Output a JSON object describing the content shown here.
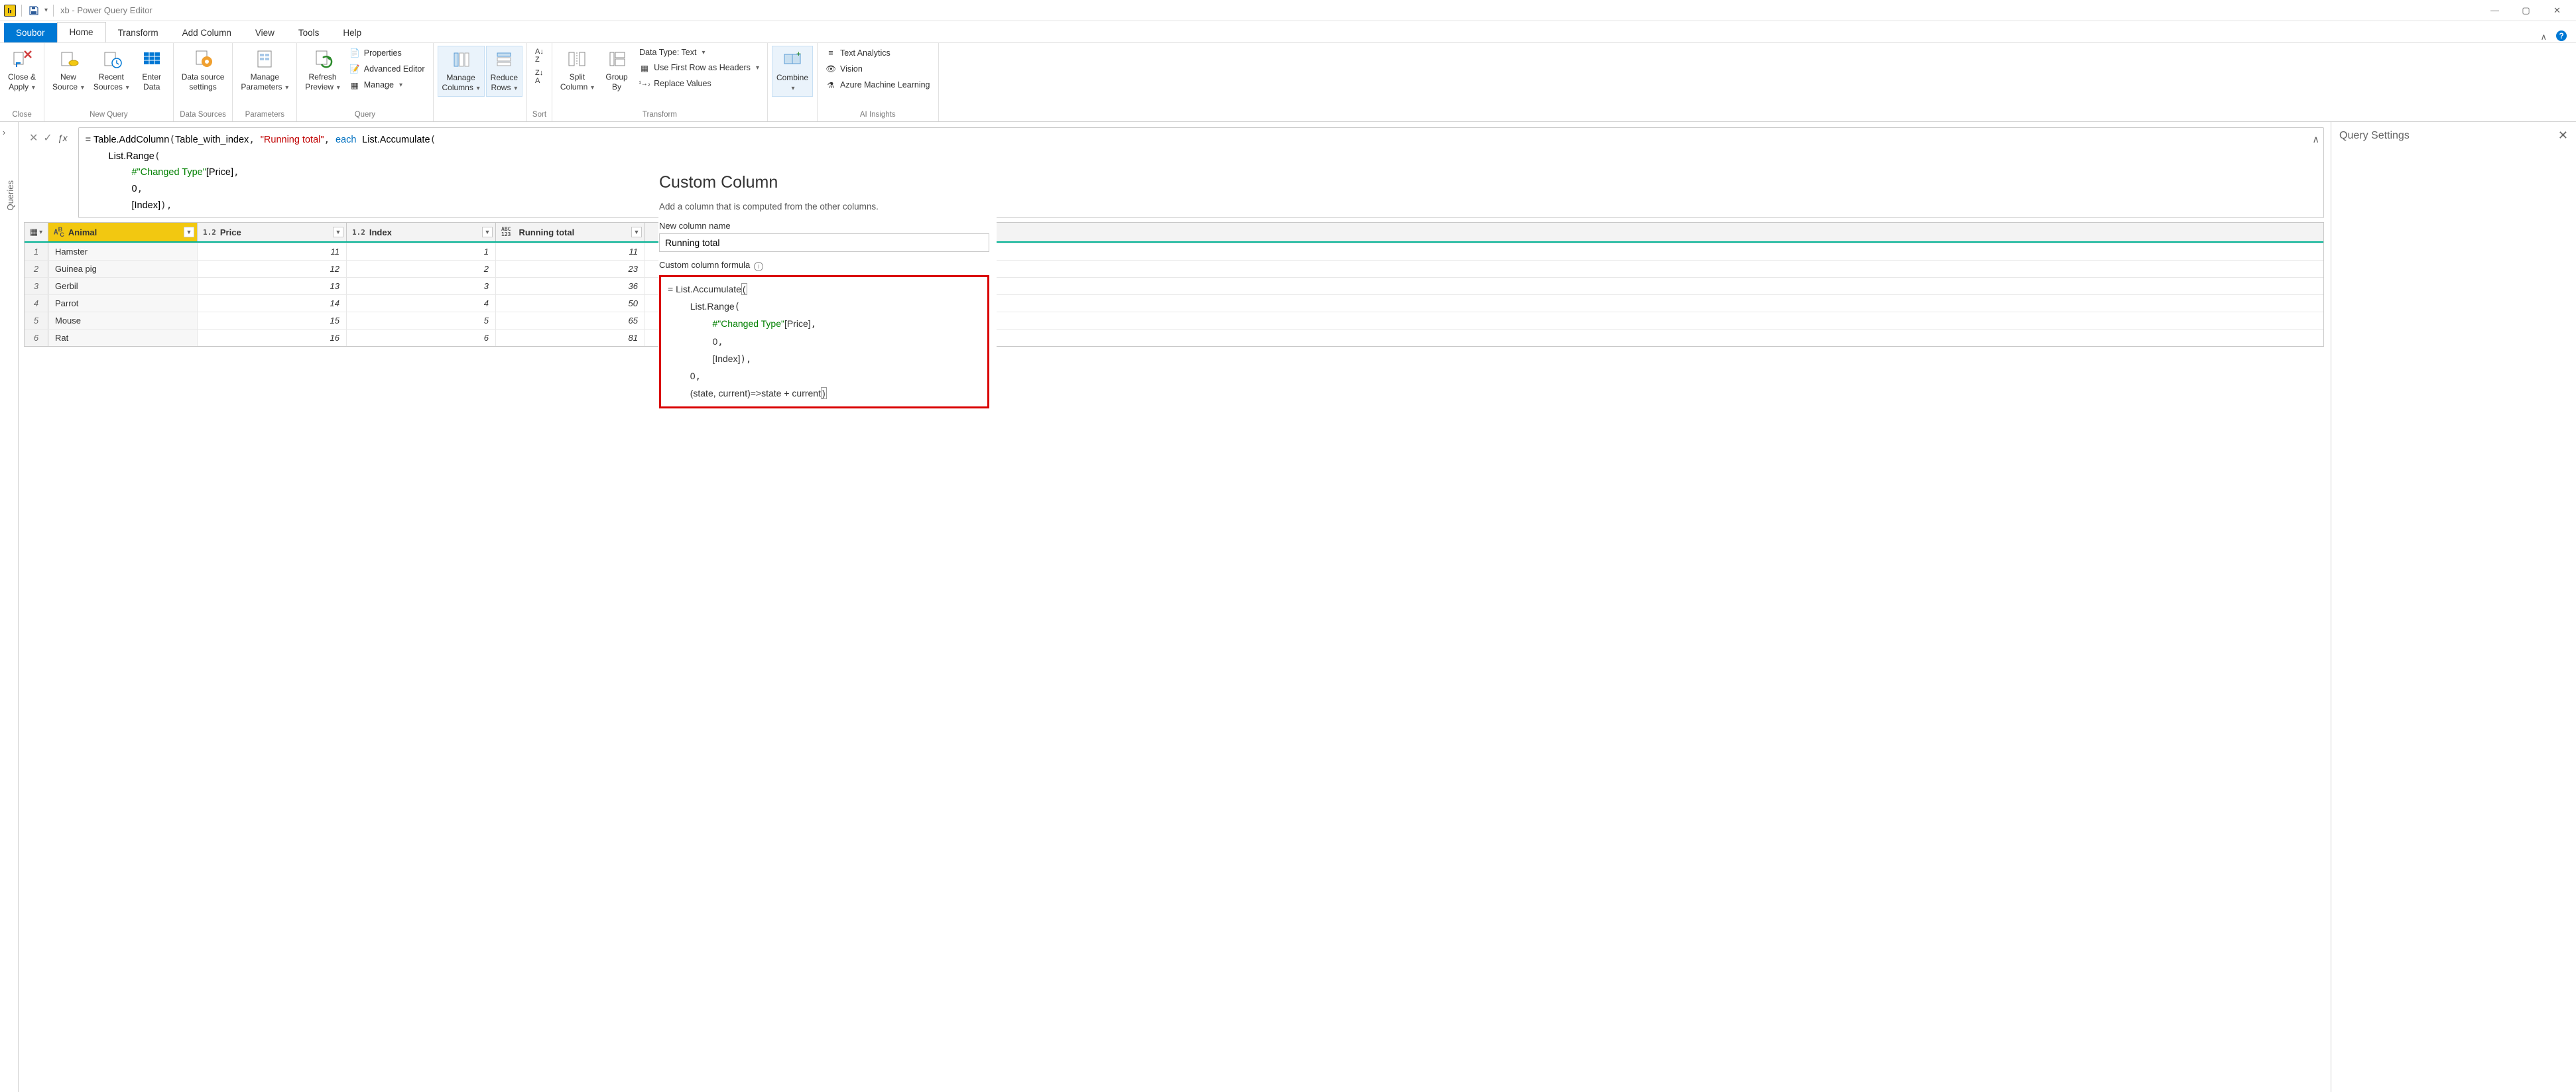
{
  "titlebar": {
    "title": "xb - Power Query Editor",
    "qat_dropdown": "▾"
  },
  "tabs": {
    "file": "Soubor",
    "items": [
      "Home",
      "Transform",
      "Add Column",
      "View",
      "Tools",
      "Help"
    ],
    "active_index": 0
  },
  "ribbon": {
    "close_apply": "Close &\nApply",
    "new_source": "New\nSource",
    "recent_sources": "Recent\nSources",
    "enter_data": "Enter\nData",
    "data_source_settings": "Data source\nsettings",
    "manage_parameters": "Manage\nParameters",
    "refresh_preview": "Refresh\nPreview",
    "properties": "Properties",
    "advanced_editor": "Advanced Editor",
    "manage": "Manage",
    "manage_columns": "Manage\nColumns",
    "reduce_rows": "Reduce\nRows",
    "split_column": "Split\nColumn",
    "group_by": "Group\nBy",
    "data_type": "Data Type: Text",
    "first_row_headers": "Use First Row as Headers",
    "replace_values": "Replace Values",
    "combine": "Combine",
    "text_analytics": "Text Analytics",
    "vision": "Vision",
    "azure_ml": "Azure Machine Learning",
    "groups": {
      "close": "Close",
      "new_query": "New Query",
      "data_sources": "Data Sources",
      "parameters": "Parameters",
      "query": "Query",
      "sort": "Sort",
      "transform": "Transform",
      "ai_insights": "AI Insights"
    }
  },
  "queries_panel": {
    "label": "Queries"
  },
  "formula_bar": {
    "prefix": "= ",
    "fn1": "Table.AddColumn",
    "arg1": "Table_with_index",
    "arg2": "\"Running total\"",
    "kw_each": "each",
    "fn2": "List.Accumulate",
    "fn3": "List.Range",
    "ref": "#\"Changed Type\"",
    "col": "[Price]",
    "zero": "0",
    "idx": "[Index]"
  },
  "grid": {
    "columns": [
      "Animal",
      "Price",
      "Index",
      "Running total"
    ],
    "type_icons": [
      "AᴮC",
      "1.2",
      "1.2",
      "ABC\n123"
    ],
    "rows": [
      {
        "n": 1,
        "animal": "Hamster",
        "price": 11,
        "index": 1,
        "running": 11
      },
      {
        "n": 2,
        "animal": "Guinea pig",
        "price": 12,
        "index": 2,
        "running": 23
      },
      {
        "n": 3,
        "animal": "Gerbil",
        "price": 13,
        "index": 3,
        "running": 36
      },
      {
        "n": 4,
        "animal": "Parrot",
        "price": 14,
        "index": 4,
        "running": 50
      },
      {
        "n": 5,
        "animal": "Mouse",
        "price": 15,
        "index": 5,
        "running": 65
      },
      {
        "n": 6,
        "animal": "Rat",
        "price": 16,
        "index": 6,
        "running": 81
      }
    ]
  },
  "right_panel": {
    "title": "Query Settings"
  },
  "dialog": {
    "title": "Custom Column",
    "description": "Add a column that is computed from the other columns.",
    "name_label": "New column name",
    "name_value": "Running total",
    "formula_label": "Custom column formula",
    "formula_eq": "= ",
    "line1_fn": "List.Accumulate",
    "line2_fn": "List.Range",
    "line3_ref": "#\"Changed Type\"",
    "line3_col": "[Price]",
    "line4_zero": "0",
    "line5_idx": "[Index]",
    "line6_zero": "0",
    "line7": "(state, current)=>state + current"
  }
}
